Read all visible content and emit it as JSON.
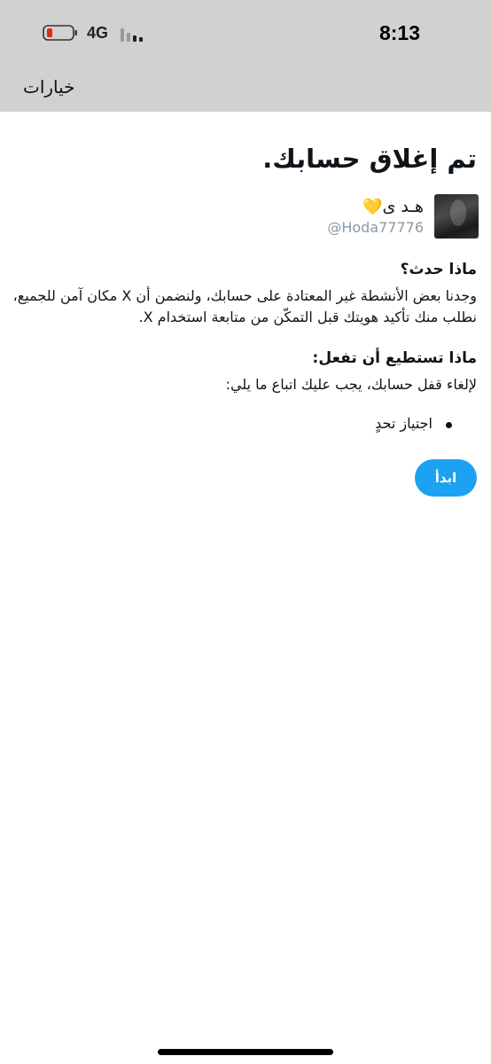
{
  "status_bar": {
    "time": "8:13",
    "network": "4G",
    "battery_color": "#e0281c",
    "icons": [
      "battery-icon",
      "signal-icon"
    ]
  },
  "nav": {
    "options_label": "خيارات"
  },
  "page": {
    "title": "تم إغلاق حسابك."
  },
  "profile": {
    "display_name": "هـد ى",
    "heart": "💛",
    "handle": "@Hoda77776"
  },
  "what_happened": {
    "heading": "ماذا حدث؟",
    "body": "وجدنا بعض الأنشطة غير المعتادة على حسابك، ولنضمن أن X مكان آمن للجميع، نطلب منك تأكيد هويتك قبل التمكّن من متابعة استخدام X."
  },
  "what_to_do": {
    "heading": "ماذا تستطيع أن تفعل:",
    "body": "لإلغاء قفل حسابك، يجب عليك اتباع ما يلي:",
    "steps": [
      "اجتياز تحدٍ"
    ]
  },
  "actions": {
    "start_label": "ابدأ",
    "accent_color": "#1da1f2"
  }
}
